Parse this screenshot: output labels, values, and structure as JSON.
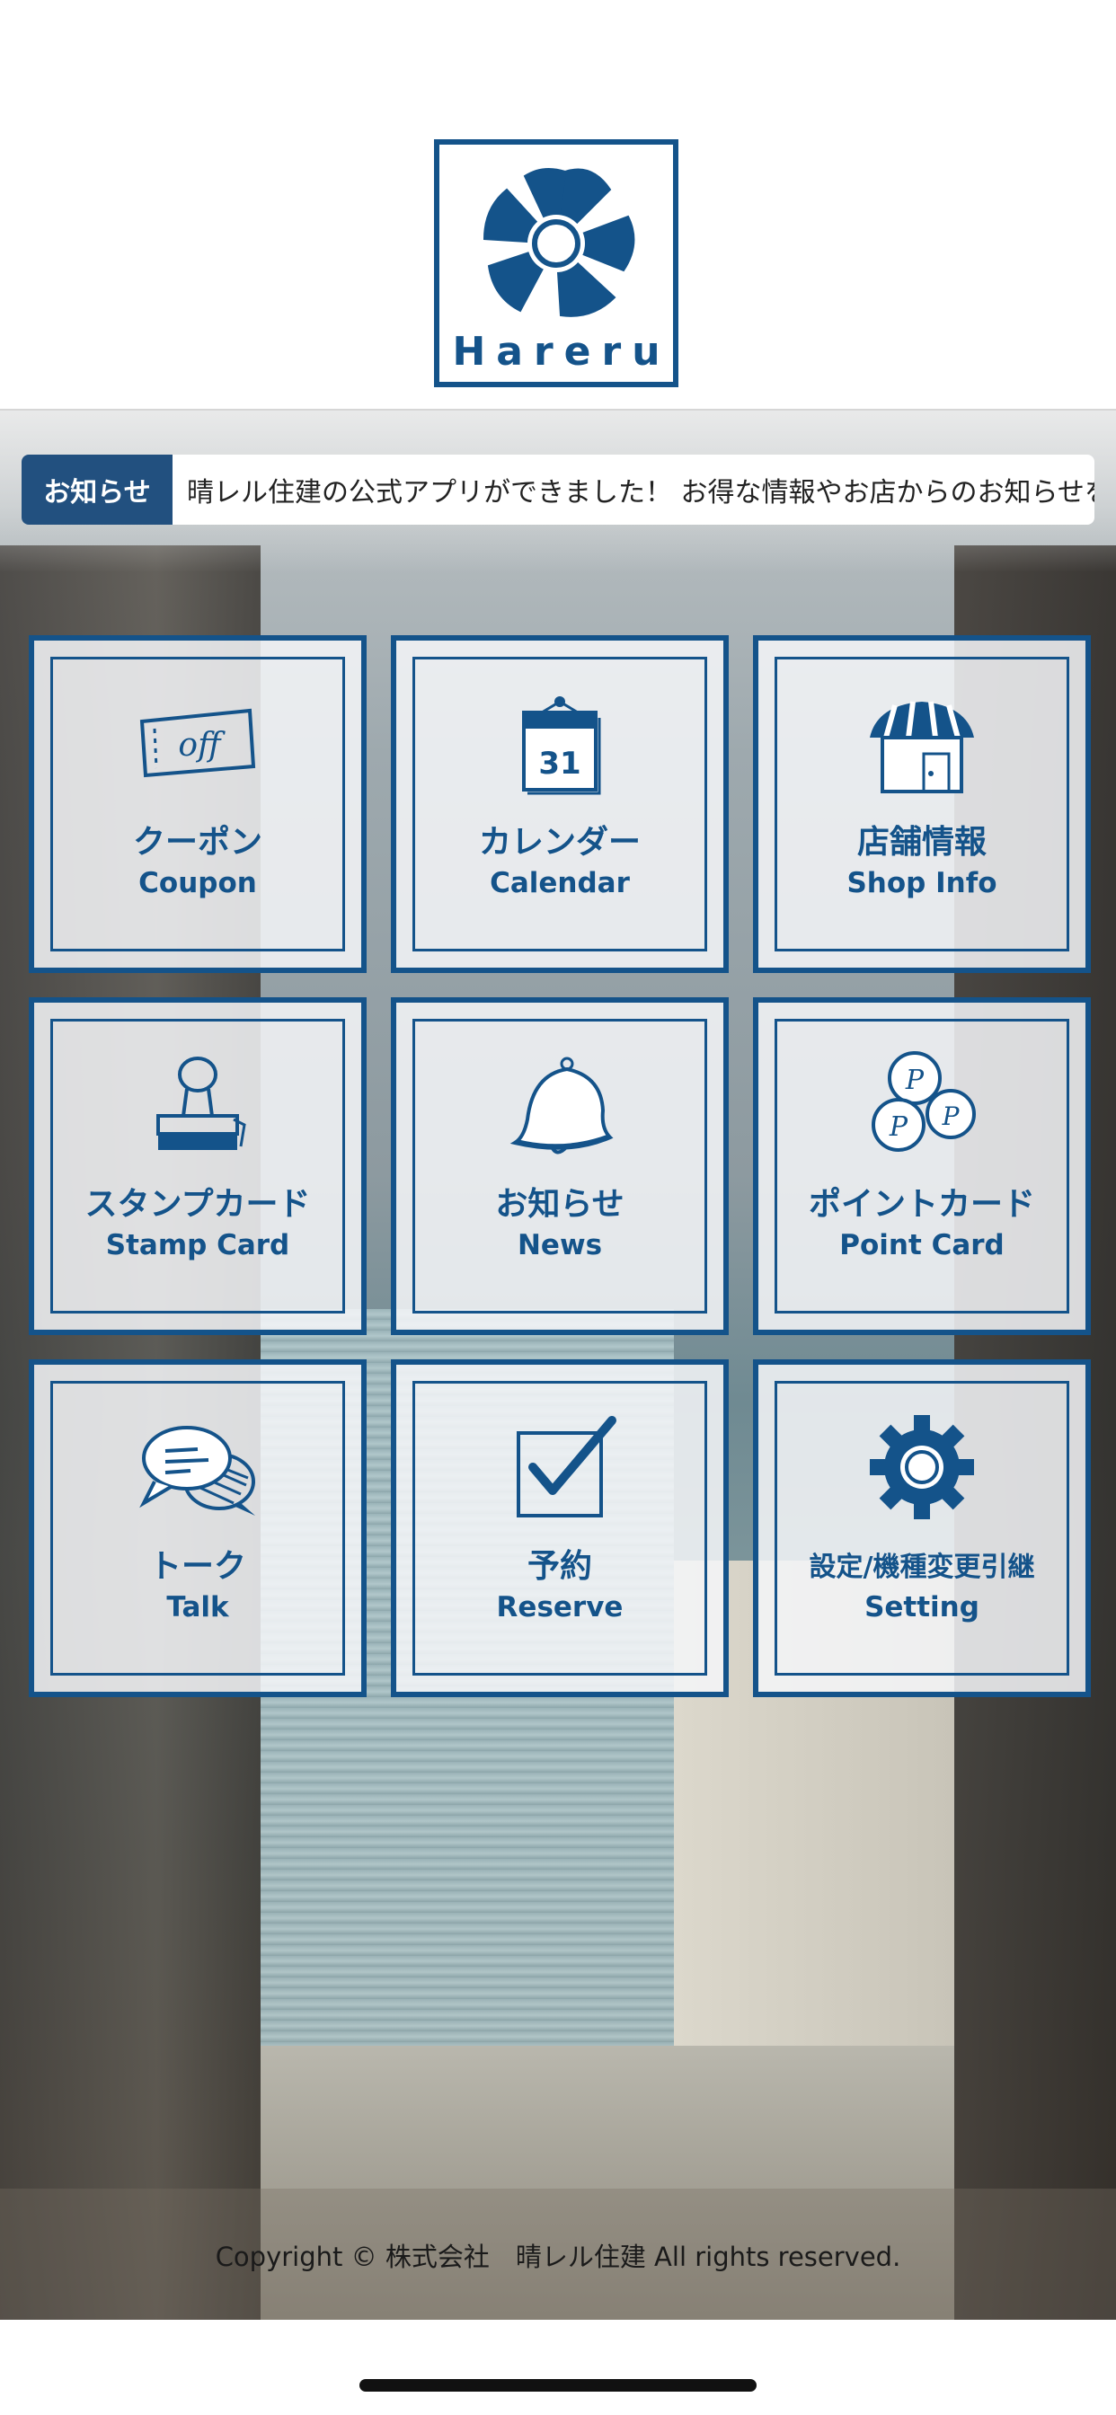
{
  "app": {
    "logo_text": "Hareru"
  },
  "notice": {
    "label": "お知らせ",
    "text": "晴レル住建の公式アプリができました！ お得な情報やお店からのお知らせを"
  },
  "tiles": [
    {
      "jp": "クーポン",
      "en": "Coupon",
      "icon": "coupon-ticket-icon"
    },
    {
      "jp": "カレンダー",
      "en": "Calendar",
      "icon": "calendar-icon"
    },
    {
      "jp": "店舗情報",
      "en": "Shop Info",
      "icon": "shop-icon"
    },
    {
      "jp": "スタンプカード",
      "en": "Stamp Card",
      "icon": "stamp-icon"
    },
    {
      "jp": "お知らせ",
      "en": "News",
      "icon": "bell-icon"
    },
    {
      "jp": "ポイントカード",
      "en": "Point Card",
      "icon": "point-coins-icon"
    },
    {
      "jp": "トーク",
      "en": "Talk",
      "icon": "chat-bubbles-icon"
    },
    {
      "jp": "予約",
      "en": "Reserve",
      "icon": "checkbox-icon"
    },
    {
      "jp": "設定/機種変更引継",
      "en": "Setting",
      "icon": "gear-icon"
    }
  ],
  "calendar_icon_day": "31",
  "coupon_icon_text": "off",
  "point_icon_letter": "P",
  "footer": {
    "copyright": "Copyright © 株式会社　晴レル住建 All rights reserved."
  },
  "colors": {
    "brand": "#14538a",
    "notice_label_bg": "#22507f"
  }
}
